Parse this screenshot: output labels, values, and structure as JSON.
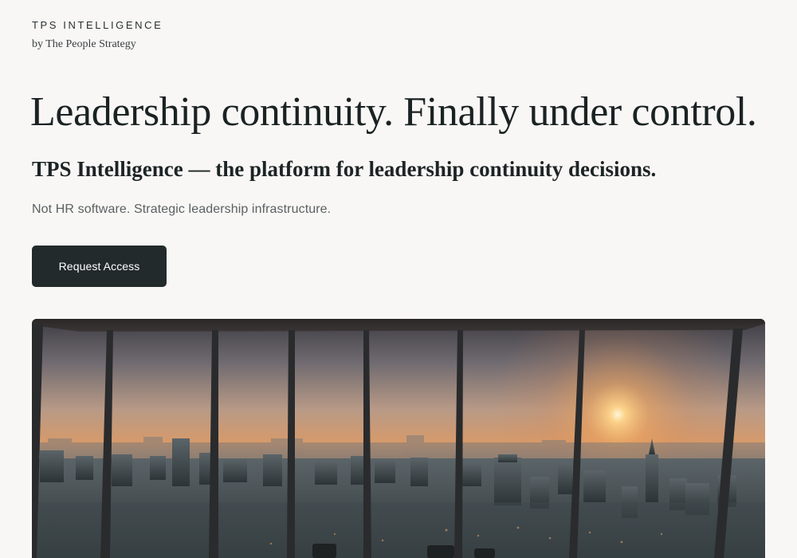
{
  "brand": {
    "name": "TPS INTELLIGENCE",
    "byline": "by The People Strategy"
  },
  "hero": {
    "headline": "Leadership continuity. Finally under control.",
    "subheadline": "TPS Intelligence — the platform for leadership continuity decisions.",
    "tagline": "Not HR software. Strategic leadership infrastructure.",
    "cta_label": "Request Access"
  },
  "image": {
    "subject": "boardroom-city-sunset-image"
  },
  "colors": {
    "background": "#f8f7f5",
    "button": "#232a2b",
    "text": "#1b2223",
    "muted": "#5b6163"
  }
}
